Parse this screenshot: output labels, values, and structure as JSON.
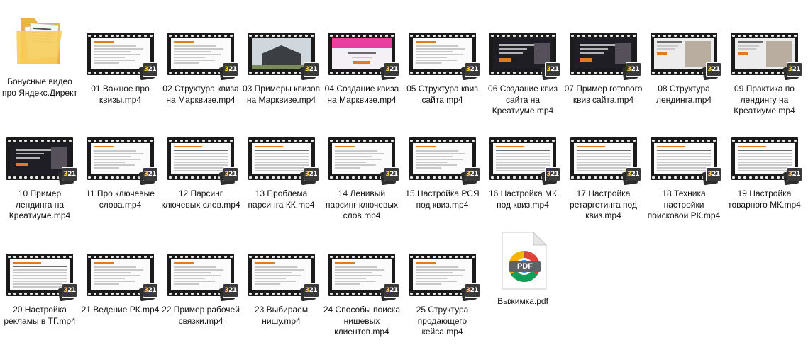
{
  "items": [
    {
      "name": "Бонусные видео про Яндекс.Директ",
      "kind": "folder"
    },
    {
      "name": "01 Важное про квизы.mp4",
      "kind": "video",
      "thumb": "doc"
    },
    {
      "name": "02 Структура квиза на Марквизе.mp4",
      "kind": "video",
      "thumb": "doc"
    },
    {
      "name": "03 Примеры квизов на Марквизе.mp4",
      "kind": "video",
      "thumb": "house"
    },
    {
      "name": "04 Создание квиза на Марквизе.mp4",
      "kind": "video",
      "thumb": "pink"
    },
    {
      "name": "05 Структура квиз сайта.mp4",
      "kind": "video",
      "thumb": "doc"
    },
    {
      "name": "06 Создание квиз сайта на Креатиуме.mp4",
      "kind": "video",
      "thumb": "dark"
    },
    {
      "name": "07 Пример готового квиз сайта.mp4",
      "kind": "video",
      "thumb": "dark"
    },
    {
      "name": "08 Структура лендинга.mp4",
      "kind": "video",
      "thumb": "land"
    },
    {
      "name": "09 Практика по лендингу на Креатиуме.mp4",
      "kind": "video",
      "thumb": "land"
    },
    {
      "name": "10 Пример лендинга на Креатиуме.mp4",
      "kind": "video",
      "thumb": "dark"
    },
    {
      "name": "11 Про ключевые слова.mp4",
      "kind": "video",
      "thumb": "doc"
    },
    {
      "name": "12 Парсинг ключевых слов.mp4",
      "kind": "video",
      "thumb": "table"
    },
    {
      "name": "13 Проблема парсинга КК.mp4",
      "kind": "video",
      "thumb": "table"
    },
    {
      "name": "14 Ленивый парсинг ключевых слов.mp4",
      "kind": "video",
      "thumb": "doc"
    },
    {
      "name": "15 Настройка РСЯ под квиз.mp4",
      "kind": "video",
      "thumb": "doc"
    },
    {
      "name": "16 Настройка МК под квиз.mp4",
      "kind": "video",
      "thumb": "table"
    },
    {
      "name": "17 Настройка ретаргетинга под квиз.mp4",
      "kind": "video",
      "thumb": "table"
    },
    {
      "name": "18 Техника настройки поисковой РК.mp4",
      "kind": "video",
      "thumb": "table"
    },
    {
      "name": "19 Настройка товарного МК.mp4",
      "kind": "video",
      "thumb": "table"
    },
    {
      "name": "20 Настройка рекламы в ТГ.mp4",
      "kind": "video",
      "thumb": "table"
    },
    {
      "name": "21 Ведение РК.mp4",
      "kind": "video",
      "thumb": "doc"
    },
    {
      "name": "22 Пример рабочей связки.mp4",
      "kind": "video",
      "thumb": "doc"
    },
    {
      "name": "23 Выбираем нишу.mp4",
      "kind": "video",
      "thumb": "doc"
    },
    {
      "name": "24 Способы поиска нишевых клиентов.mp4",
      "kind": "video",
      "thumb": "doc"
    },
    {
      "name": "25 Структура продающего кейса.mp4",
      "kind": "video",
      "thumb": "doc"
    },
    {
      "name": "Выжимка.pdf",
      "kind": "pdf"
    }
  ],
  "badge_text": "321",
  "pdf_badge": "PDF",
  "colors": {
    "accent_orange": "#e07b1e",
    "pdf_red": "#d32f2f",
    "folder_yellow": "#f3c24f"
  }
}
